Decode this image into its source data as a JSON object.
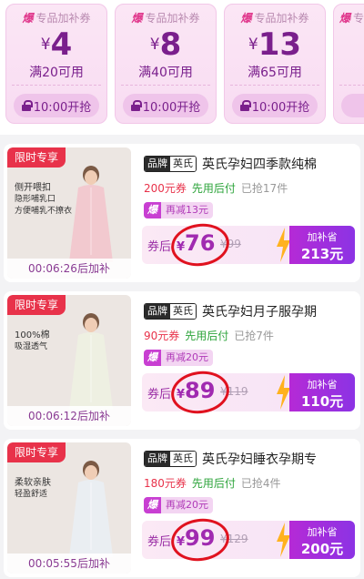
{
  "coupons": [
    {
      "tag_icon": "爆",
      "tag": "专品加补券",
      "currency": "¥",
      "amount": "4",
      "condition": "满20可用",
      "button": "10:00开抢"
    },
    {
      "tag_icon": "爆",
      "tag": "专品加补券",
      "currency": "¥",
      "amount": "8",
      "condition": "满40可用",
      "button": "10:00开抢"
    },
    {
      "tag_icon": "爆",
      "tag": "专品加补券",
      "currency": "¥",
      "amount": "13",
      "condition": "满65可用",
      "button": "10:00开抢"
    },
    {
      "tag_icon": "爆",
      "tag": "专品加补券",
      "currency": "¥",
      "amount": "",
      "condition": "",
      "button": ""
    }
  ],
  "products": [
    {
      "ribbon": "限时专享",
      "blurb": [
        "侧开喂扣",
        "隐形哺乳口",
        "方便哺乳不撩衣"
      ],
      "timer": "00:06:26后加补",
      "brand_label": "品牌",
      "brand_name": "英氏",
      "title": "英氏孕妇四季款纯棉",
      "coupon": "200元券",
      "pay_later": "先用后付",
      "sold": "已抢17件",
      "extra_tag": "爆",
      "extra_text": "再减13元",
      "price_prefix": "券后",
      "currency": "¥",
      "price": "76",
      "original": "¥99",
      "add_save_label": "加补省",
      "add_save_value": "213元",
      "garment_color": "#f2c9cf"
    },
    {
      "ribbon": "限时专享",
      "blurb": [
        "100%棉",
        "吸湿透气"
      ],
      "timer": "00:06:12后加补",
      "brand_label": "品牌",
      "brand_name": "英氏",
      "title": "英氏孕妇月子服孕期",
      "coupon": "90元券",
      "pay_later": "先用后付",
      "sold": "已抢7件",
      "extra_tag": "爆",
      "extra_text": "再减20元",
      "price_prefix": "券后",
      "currency": "¥",
      "price": "89",
      "original": "¥119",
      "add_save_label": "加补省",
      "add_save_value": "110元",
      "garment_color": "#eef0e2"
    },
    {
      "ribbon": "限时专享",
      "blurb": [
        "柔软亲肤",
        "轻盈舒适"
      ],
      "timer": "00:05:55后加补",
      "brand_label": "品牌",
      "brand_name": "英氏",
      "title": "英氏孕妇睡衣孕期专",
      "coupon": "180元券",
      "pay_later": "先用后付",
      "sold": "已抢4件",
      "extra_tag": "爆",
      "extra_text": "再减20元",
      "price_prefix": "券后",
      "currency": "¥",
      "price": "99",
      "original": "¥129",
      "add_save_label": "加补省",
      "add_save_value": "200元",
      "garment_color": "#eaeef2"
    }
  ]
}
